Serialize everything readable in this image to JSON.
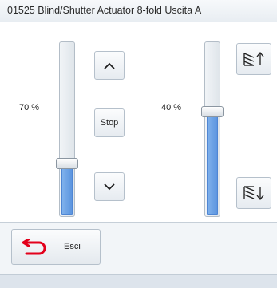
{
  "window": {
    "title": "01525 Blind/Shutter Actuator 8-fold Uscita A"
  },
  "left": {
    "percent_label": "70 %",
    "level": 0.3,
    "up_icon": "chevron-up-icon",
    "stop_label": "Stop",
    "down_icon": "chevron-down-icon"
  },
  "right": {
    "percent_label": "40 %",
    "level": 0.6,
    "up_icon": "slat-tilt-up-icon",
    "down_icon": "slat-tilt-down-icon"
  },
  "footer": {
    "exit_label": "Esci",
    "exit_icon": "undo-arrow-icon",
    "accent": "#e3001b"
  }
}
